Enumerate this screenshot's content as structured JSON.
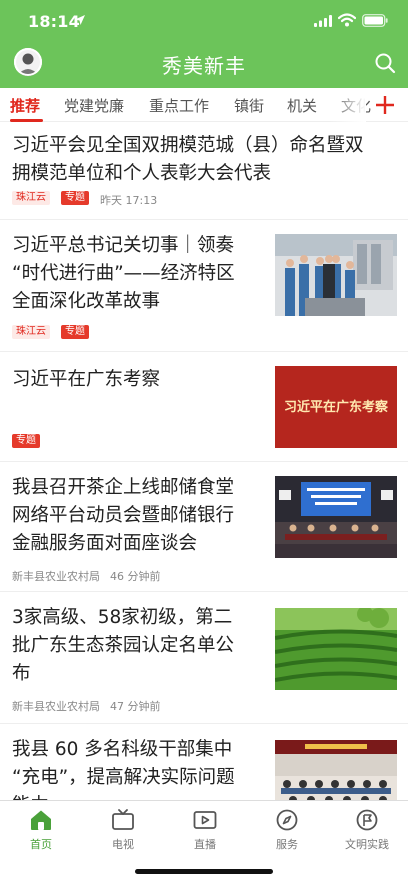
{
  "status_bar": {
    "time": "18:14"
  },
  "header": {
    "title": "秀美新丰"
  },
  "tabs": [
    {
      "label": "推荐"
    },
    {
      "label": "党建党廉"
    },
    {
      "label": "重点工作"
    },
    {
      "label": "镇街"
    },
    {
      "label": "机关"
    },
    {
      "label": "文化"
    }
  ],
  "feed": [
    {
      "title_lines": [
        "习近平会见全国双拥模范城（县）命名暨双",
        "拥模范单位和个人表彰大会代表"
      ],
      "source_badge": "珠江云",
      "topic_badge": "专题",
      "time": "昨天 17:13"
    },
    {
      "title_lines": [
        "习近平总书记关切事｜领奏",
        "“时代进行曲”——经济特区",
        "全面深化改革故事"
      ],
      "source_badge": "珠江云",
      "topic_badge": "专题"
    },
    {
      "title_lines": [
        "习近平在广东考察"
      ],
      "topic_badge": "专题",
      "thumb_text": "习近平在广东考察"
    },
    {
      "title_lines": [
        "我县召开茶企上线邮储食堂",
        "网络平台动员会暨邮储银行",
        "金融服务面对面座谈会"
      ],
      "source": "新丰县农业农村局",
      "time": "46 分钟前"
    },
    {
      "title_lines": [
        "3家高级、58家初级，第二",
        "批广东生态茶园认定名单公",
        "布"
      ],
      "source": "新丰县农业农村局",
      "time": "47 分钟前"
    },
    {
      "title_lines": [
        "我县 60 多名科级干部集中",
        "“充电”，提高解决实际问题",
        "能力"
      ]
    }
  ],
  "bottom_nav": [
    {
      "label": "首页",
      "icon": "home-icon"
    },
    {
      "label": "电视",
      "icon": "tv-icon"
    },
    {
      "label": "直播",
      "icon": "live-icon"
    },
    {
      "label": "服务",
      "icon": "compass-icon"
    },
    {
      "label": "文明实践",
      "icon": "flag-icon"
    }
  ],
  "colors": {
    "brand_green": "#6cc45a",
    "accent_red": "#e0281e"
  }
}
